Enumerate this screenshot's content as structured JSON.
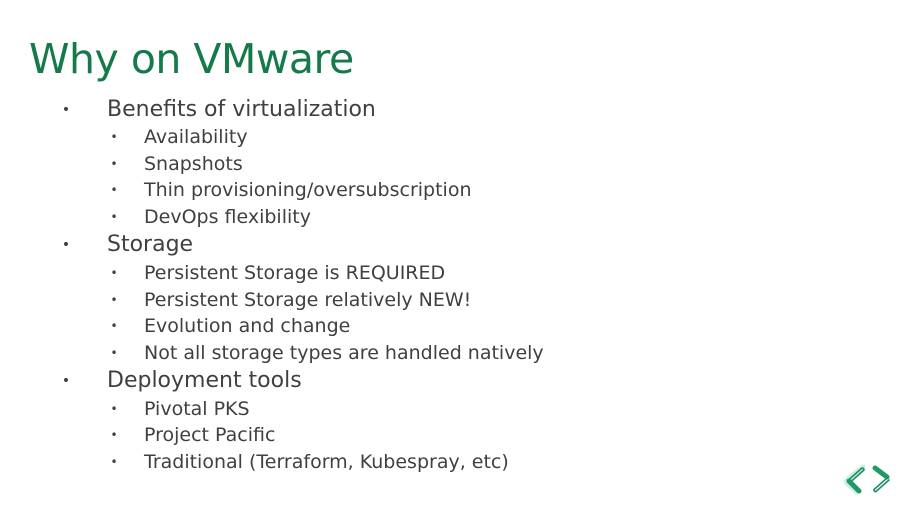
{
  "slide": {
    "title": "Why on VMware",
    "sections": [
      {
        "heading": "Benefits of virtualization",
        "items": [
          "Availability",
          "Snapshots",
          "Thin provisioning/oversubscription",
          "DevOps flexibility"
        ]
      },
      {
        "heading": "Storage",
        "items": [
          "Persistent Storage is REQUIRED",
          "Persistent Storage relatively NEW!",
          "Evolution and change",
          "Not all storage types are handled natively"
        ]
      },
      {
        "heading": "Deployment tools",
        "items": [
          "Pivotal PKS",
          "Project Pacific",
          "Traditional (Terraform, Kubespray, etc)"
        ]
      }
    ],
    "bullet_glyph": "•",
    "logo_icon": "chevrons-left-right-icon"
  },
  "colors": {
    "title": "#157a4a",
    "body_text": "#404040",
    "logo_dark": "#1f8f5f",
    "logo_light": "#2bbf8c"
  }
}
